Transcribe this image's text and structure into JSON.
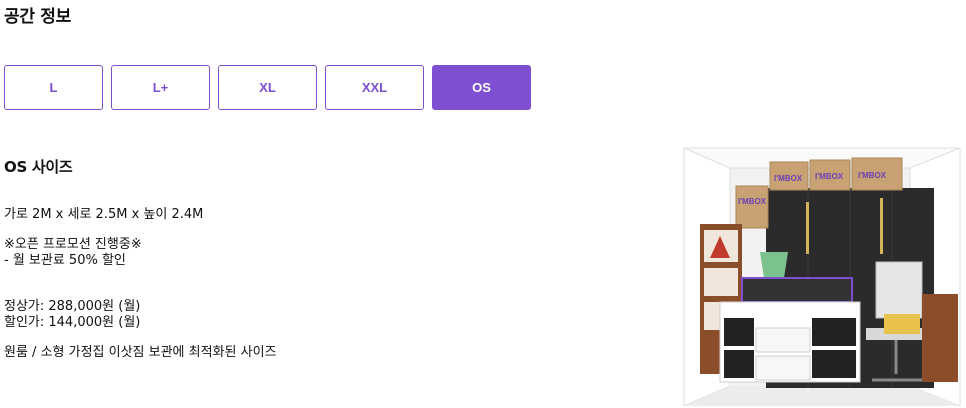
{
  "section_title": "공간 정보",
  "size_tabs": [
    {
      "label": "L",
      "active": false
    },
    {
      "label": "L+",
      "active": false
    },
    {
      "label": "XL",
      "active": false
    },
    {
      "label": "XXL",
      "active": false
    },
    {
      "label": "OS",
      "active": true
    }
  ],
  "detail": {
    "heading": "OS 사이즈",
    "dimensions": "가로 2M x 세로 2.5M x 높이 2.4M",
    "promo_line1": "※오픈 프로모션 진행중※",
    "promo_line2": "- 월 보관료 50% 할인",
    "regular_price": "정상가: 288,000원 (월)",
    "sale_price": "할인가: 144,000원 (월)",
    "description": "원룸 / 소형 가정집 이삿짐 보관에 최적화된 사이즈"
  },
  "illustration": {
    "box_brand": "I'MBOX",
    "colors": {
      "accent": "#7e4fd0",
      "cabinet": "#2b2b2b",
      "box": "#c9a273",
      "shelf": "#8a4f2a"
    }
  }
}
